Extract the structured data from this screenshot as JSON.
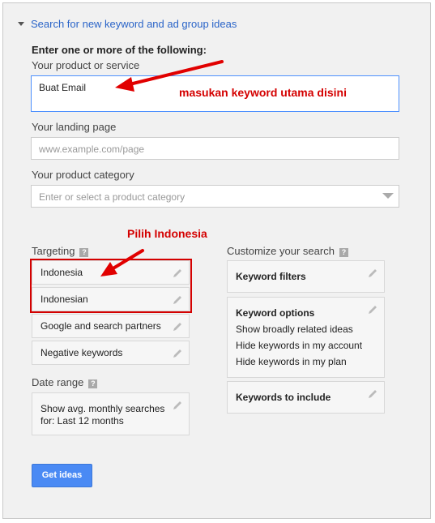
{
  "header": {
    "title": "Search for new keyword and ad group ideas"
  },
  "form": {
    "intro": "Enter one or more of the following:",
    "product_label": "Your product or service",
    "product_value": "Buat Email",
    "landing_label": "Your landing page",
    "landing_placeholder": "www.example.com/page",
    "category_label": "Your product category",
    "category_placeholder": "Enter or select a product category"
  },
  "targeting": {
    "label": "Targeting",
    "items": [
      "Indonesia",
      "Indonesian",
      "Google and search partners",
      "Negative keywords"
    ]
  },
  "date_range": {
    "label": "Date range",
    "line1": "Show avg. monthly searches",
    "line2": "for: Last 12 months"
  },
  "customize": {
    "label": "Customize your search",
    "keyword_filters": "Keyword filters",
    "keyword_options_title": "Keyword options",
    "keyword_options": [
      "Show broadly related ideas",
      "Hide keywords in my account",
      "Hide keywords in my plan"
    ],
    "keywords_to_include": "Keywords to include"
  },
  "annotations": {
    "keyword_note": "masukan keyword utama disini",
    "country_note": "Pilih Indonesia",
    "color": "#d40000"
  },
  "button": {
    "label": "Get ideas"
  },
  "help_glyph": "?"
}
